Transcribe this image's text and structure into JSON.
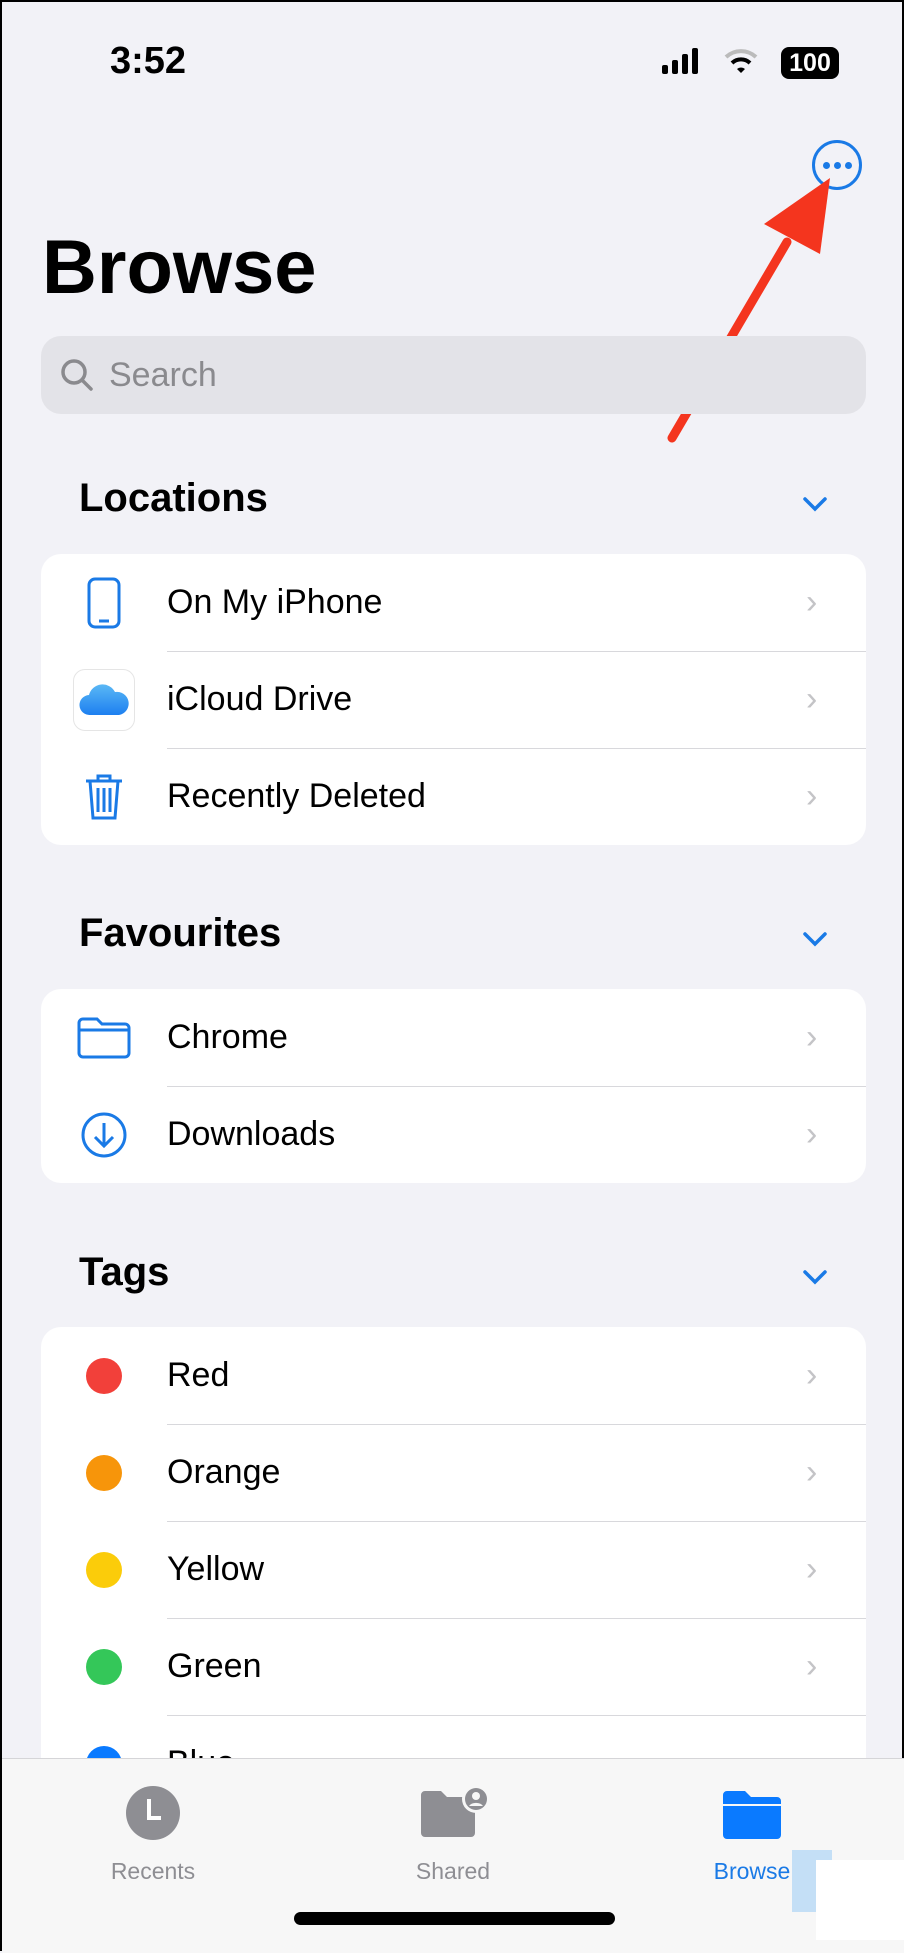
{
  "status": {
    "time": "3:52",
    "battery": "100"
  },
  "header": {
    "title": "Browse",
    "search_placeholder": "Search"
  },
  "sections": {
    "locations": {
      "title": "Locations",
      "items": [
        {
          "label": "On My iPhone",
          "icon": "iphone-icon"
        },
        {
          "label": "iCloud Drive",
          "icon": "icloud-icon"
        },
        {
          "label": "Recently Deleted",
          "icon": "trash-icon"
        }
      ]
    },
    "favourites": {
      "title": "Favourites",
      "items": [
        {
          "label": "Chrome",
          "icon": "folder-icon"
        },
        {
          "label": "Downloads",
          "icon": "download-icon"
        }
      ]
    },
    "tags": {
      "title": "Tags",
      "items": [
        {
          "label": "Red",
          "color": "#f2403a"
        },
        {
          "label": "Orange",
          "color": "#f7950a"
        },
        {
          "label": "Yellow",
          "color": "#fbcc0a"
        },
        {
          "label": "Green",
          "color": "#34c759"
        },
        {
          "label": "Blue",
          "color": "#0a7aff"
        }
      ]
    }
  },
  "tabbar": {
    "items": [
      {
        "label": "Recents",
        "active": false
      },
      {
        "label": "Shared",
        "active": false
      },
      {
        "label": "Browse",
        "active": true
      }
    ]
  },
  "colors": {
    "accent": "#1a7ae6",
    "annotation_arrow": "#f4351e"
  }
}
